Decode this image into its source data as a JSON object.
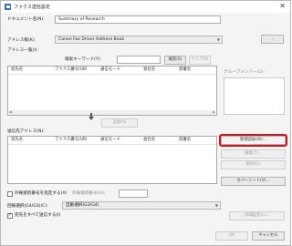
{
  "window": {
    "title": "ファクス送信設定"
  },
  "document_name": {
    "label": "ドキュメント名(N):",
    "value": "Summary of Research"
  },
  "address_book": {
    "label": "アドレス帳(K):",
    "value": "Canon Fax Driver Address Book"
  },
  "address_list": {
    "label": "アドレス一覧(I):",
    "search_label": "検索キーワード(Y):",
    "search_button": "検索(S)",
    "clear_button": "クリア(R)",
    "columns": [
      "宛先名",
      "ファクス番号/URI",
      "通信モード",
      "会社名",
      "部署名"
    ],
    "group_members_label": "グループメンバー(G):"
  },
  "add_button": "追加(A)",
  "destination_list": {
    "label": "送信先アドレス(N):",
    "columns": [
      "宛先名",
      "ファクス番号/URI",
      "通信モード",
      "会社名",
      "部署名"
    ]
  },
  "side_buttons": {
    "new_destination": "新規追加(W)...",
    "edit": "編集(T)...",
    "delete": "削除(D)",
    "coversheet": "カバーシート(V)..."
  },
  "outside_line": {
    "label": "外線接続番号を指定する(X)",
    "number_label": "外線接続番号(O):",
    "number_value": ""
  },
  "line_select": {
    "label": "回線選択(G4/G3)(C):",
    "value": "自動選択(G3/G4)"
  },
  "notify": {
    "label": "宛先をすべて送信する(I)",
    "checked": true
  },
  "details_button": "詳細設定(L)...",
  "ok_button": "OK",
  "cancel_button": "キャンセル"
}
